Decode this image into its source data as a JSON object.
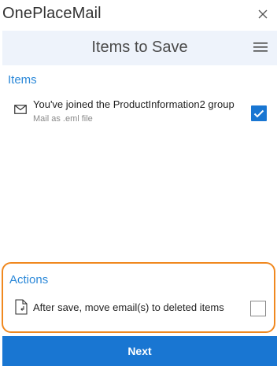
{
  "app": {
    "title": "OnePlaceMail",
    "close_icon": "close-icon"
  },
  "subheader": {
    "title": "Items to Save",
    "menu_icon": "hamburger-menu-icon",
    "background": "#eef3fb"
  },
  "items_section": {
    "title": "Items",
    "items": [
      {
        "icon": "mail-icon",
        "subject": "You've joined the ProductInformation2 group",
        "subtext": "Mail as .eml file",
        "checked": true
      }
    ]
  },
  "actions_section": {
    "title": "Actions",
    "highlight_color": "#f0881f",
    "actions": [
      {
        "icon": "document-move-icon",
        "label": "After save, move email(s) to deleted items",
        "checked": false
      }
    ]
  },
  "footer": {
    "next_label": "Next"
  },
  "colors": {
    "accent": "#1976d2",
    "section_title": "#2b88d8"
  }
}
